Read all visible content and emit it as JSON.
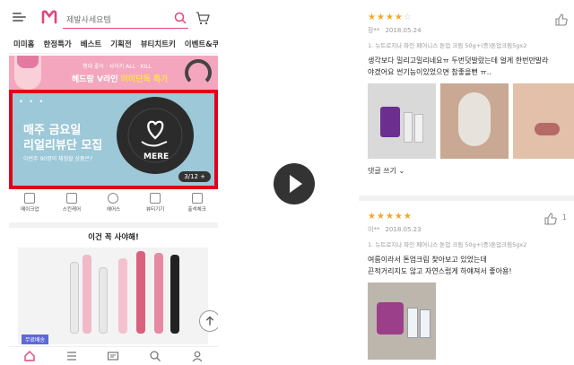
{
  "left": {
    "search_placeholder": "제발사세요템",
    "nav": [
      "미미홈",
      "한정특가",
      "베스트",
      "기획전",
      "뷰티치트키",
      "이벤트&쿠"
    ],
    "promo_banner": {
      "small_text": "챙대 좋아 · 사이키 ALL · KILL",
      "main_text": "헤드랑 V라인",
      "highlight": "미미단독 특가"
    },
    "hero": {
      "dots": "• • •",
      "line1": "매주 금요일",
      "line2": "리얼리뷰단 모집",
      "line3": "이번주 90명이 체험할 상품은?",
      "brand": "MERE",
      "counter": "3/12 +"
    },
    "categories": [
      {
        "label": "메이크업",
        "icon": "lipstick-icon"
      },
      {
        "label": "스킨케어",
        "icon": "skincare-icon"
      },
      {
        "label": "헤어스",
        "icon": "hair-icon"
      },
      {
        "label": "뷰티기기",
        "icon": "device-icon"
      },
      {
        "label": "출석체크",
        "icon": "calendar-icon"
      }
    ],
    "section_title": "이건 꼭 사야해!",
    "product_tag": "무료배송",
    "bottom_nav": [
      "home-icon",
      "menu-icon",
      "ticket-icon",
      "search-icon",
      "profile-icon"
    ],
    "colors": {
      "accent": "#e0467a",
      "hero_bg": "#9cc8d7",
      "highlight_border": "#e3001b",
      "banner_bg": "#f4a6be"
    }
  },
  "right": {
    "reviews": [
      {
        "stars": 4,
        "user": "장**",
        "date": "2018.05.24",
        "option": "1. 뉴트로지나 파인 페어니스 톤업 크림 50g+(증)톤업크림5gx2",
        "text_lines": [
          "생각보다 밀리고밀리네요ㅠ 두번덧발랐는데 얼게 한번만발라",
          "야겠어요 썬기능이있었으면 참좋을뻔 ㅠ.."
        ],
        "likes": "",
        "comment": "댓글 쓰기"
      },
      {
        "stars": 5,
        "user": "이**",
        "date": "2018.05.23",
        "option": "1. 뉴트로지나 파인 페어니스 톤업 크림 50g+(증)톤업크림5gx2",
        "text_lines": [
          "여름이라서 톤업크림 찾아보고 있었는데",
          "끈적거리지도 않고 자연스럽게 하얘져서 좋아용!"
        ],
        "likes": "1"
      }
    ],
    "colors": {
      "star": "#f5a623"
    }
  }
}
